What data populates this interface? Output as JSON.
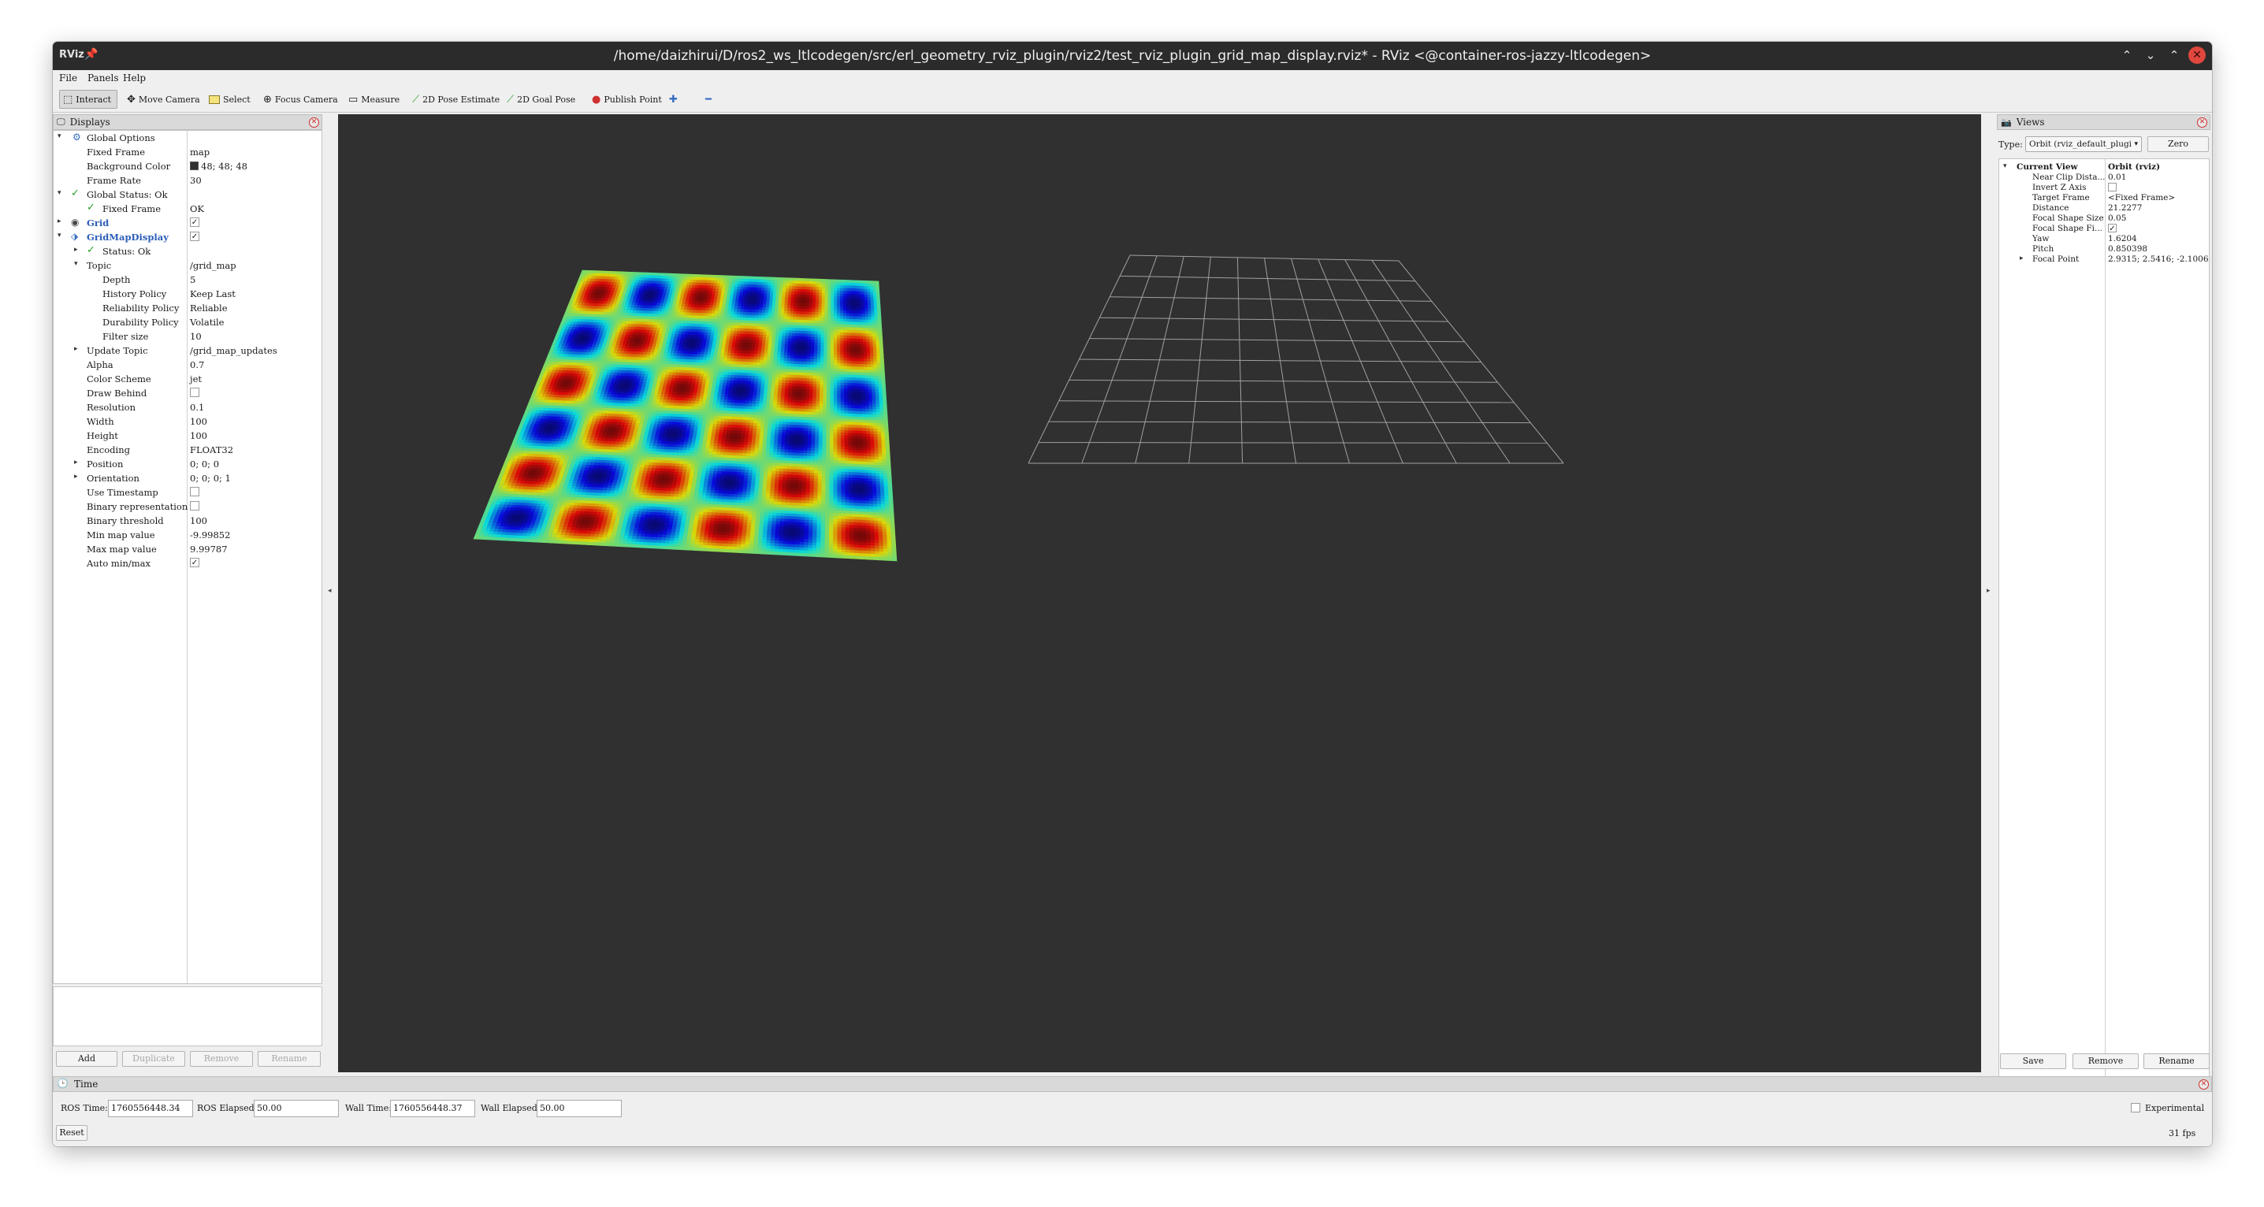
{
  "window": {
    "title": "/home/daizhirui/D/ros2_ws_ltlcodegen/src/erl_geometry_rviz_plugin/rviz2/test_rviz_plugin_grid_map_display.rviz* - RViz <@container-ros-jazzy-ltlcodegen>",
    "logo": "RViz"
  },
  "menu": {
    "file": "File",
    "panels": "Panels",
    "help": "Help"
  },
  "toolbar": {
    "interact": "Interact",
    "move_camera": "Move Camera",
    "select": "Select",
    "focus_camera": "Focus Camera",
    "measure": "Measure",
    "pose_estimate": "2D Pose Estimate",
    "goal_pose": "2D Goal Pose",
    "publish_point": "Publish Point"
  },
  "displays": {
    "title": "Displays",
    "rows": {
      "global_options": "Global Options",
      "fixed_frame": {
        "key": "Fixed Frame",
        "value": "map"
      },
      "background_color": {
        "key": "Background Color",
        "value": "48; 48; 48",
        "swatch": "#303030"
      },
      "frame_rate": {
        "key": "Frame Rate",
        "value": "30"
      },
      "global_status": "Global Status: Ok",
      "status_fixed_frame": {
        "key": "Fixed Frame",
        "value": "OK"
      },
      "grid": "Grid",
      "gridmap": "GridMapDisplay",
      "status_ok": "Status: Ok",
      "topic": {
        "key": "Topic",
        "value": "/grid_map"
      },
      "depth": {
        "key": "Depth",
        "value": "5"
      },
      "history": {
        "key": "History Policy",
        "value": "Keep Last"
      },
      "reliability": {
        "key": "Reliability Policy",
        "value": "Reliable"
      },
      "durability": {
        "key": "Durability Policy",
        "value": "Volatile"
      },
      "filter": {
        "key": "Filter size",
        "value": "10"
      },
      "update_topic": {
        "key": "Update Topic",
        "value": "/grid_map_updates"
      },
      "alpha": {
        "key": "Alpha",
        "value": "0.7"
      },
      "color_scheme": {
        "key": "Color Scheme",
        "value": "jet"
      },
      "draw_behind": {
        "key": "Draw Behind"
      },
      "resolution": {
        "key": "Resolution",
        "value": "0.1"
      },
      "width": {
        "key": "Width",
        "value": "100"
      },
      "height": {
        "key": "Height",
        "value": "100"
      },
      "encoding": {
        "key": "Encoding",
        "value": "FLOAT32"
      },
      "position": {
        "key": "Position",
        "value": "0; 0; 0"
      },
      "orientation": {
        "key": "Orientation",
        "value": "0; 0; 0; 1"
      },
      "use_timestamp": {
        "key": "Use Timestamp"
      },
      "binary_repr": {
        "key": "Binary representation"
      },
      "binary_threshold": {
        "key": "Binary threshold",
        "value": "100"
      },
      "min_map": {
        "key": "Min map value",
        "value": "-9.99852"
      },
      "max_map": {
        "key": "Max map value",
        "value": "9.99787"
      },
      "auto_minmax": {
        "key": "Auto min/max"
      }
    },
    "buttons": {
      "add": "Add",
      "duplicate": "Duplicate",
      "remove": "Remove",
      "rename": "Rename"
    }
  },
  "views": {
    "title": "Views",
    "type_label": "Type:",
    "type_value": "Orbit (rviz_default_plugi",
    "zero": "Zero",
    "current_view": {
      "key": "Current View",
      "value": "Orbit (rviz)"
    },
    "rows": {
      "near_clip": {
        "key": "Near Clip Dista...",
        "value": "0.01"
      },
      "invert_z": {
        "key": "Invert Z Axis"
      },
      "target_frame": {
        "key": "Target Frame",
        "value": "<Fixed Frame>"
      },
      "distance": {
        "key": "Distance",
        "value": "21.2277"
      },
      "focal_size": {
        "key": "Focal Shape Size",
        "value": "0.05"
      },
      "focal_fixed": {
        "key": "Focal Shape Fi..."
      },
      "yaw": {
        "key": "Yaw",
        "value": "1.6204"
      },
      "pitch": {
        "key": "Pitch",
        "value": "0.850398"
      },
      "focal_point": {
        "key": "Focal Point",
        "value": "2.9315; 2.5416; -2.1006"
      }
    },
    "buttons": {
      "save": "Save",
      "remove": "Remove",
      "rename": "Rename"
    }
  },
  "time": {
    "title": "Time",
    "ros_time_label": "ROS Time:",
    "ros_time": "1760556448.34",
    "ros_elapsed_label": "ROS Elapsed:",
    "ros_elapsed": "50.00",
    "wall_time_label": "Wall Time:",
    "wall_time": "1760556448.37",
    "wall_elapsed_label": "Wall Elapsed:",
    "wall_elapsed": "50.00",
    "experimental": "Experimental",
    "reset": "Reset",
    "fps": "31 fps"
  },
  "scene": {
    "background": "#303030",
    "grid_color": "#a0a0a0",
    "map_cells": 100,
    "map_periods": 3
  }
}
